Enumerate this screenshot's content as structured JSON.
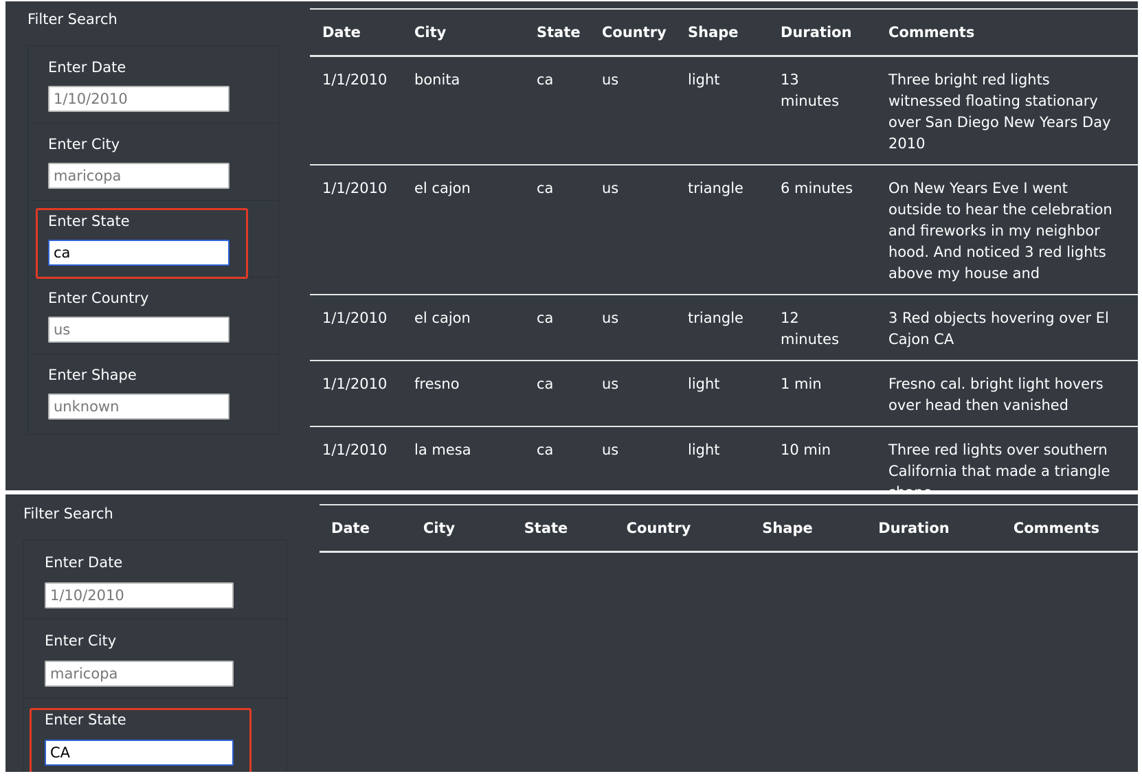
{
  "top": {
    "filter_title": "Filter Search",
    "filters": [
      {
        "label": "Enter Date",
        "placeholder": "1/10/2010",
        "value": ""
      },
      {
        "label": "Enter City",
        "placeholder": "maricopa",
        "value": ""
      },
      {
        "label": "Enter State",
        "placeholder": "",
        "value": "ca"
      },
      {
        "label": "Enter Country",
        "placeholder": "us",
        "value": ""
      },
      {
        "label": "Enter Shape",
        "placeholder": "unknown",
        "value": ""
      }
    ],
    "headers": [
      "Date",
      "City",
      "State",
      "Country",
      "Shape",
      "Duration",
      "Comments"
    ],
    "rows": [
      [
        "1/1/2010",
        "bonita",
        "ca",
        "us",
        "light",
        "13 minutes",
        "Three bright red lights witnessed floating stationary over San Diego New Years Day 2010"
      ],
      [
        "1/1/2010",
        "el cajon",
        "ca",
        "us",
        "triangle",
        "6 minutes",
        "On New Years Eve I went outside to hear the celebration and fireworks in my neighbor hood. And noticed 3 red lights above my house and"
      ],
      [
        "1/1/2010",
        "el cajon",
        "ca",
        "us",
        "triangle",
        "12 minutes",
        "3 Red objects hovering over El Cajon CA"
      ],
      [
        "1/1/2010",
        "fresno",
        "ca",
        "us",
        "light",
        "1 min",
        "Fresno cal. bright light hovers over head then vanished"
      ],
      [
        "1/1/2010",
        "la mesa",
        "ca",
        "us",
        "light",
        "10 min",
        "Three red lights over southern California that made a triangle shape"
      ]
    ]
  },
  "bottom": {
    "filter_title": "Filter Search",
    "filters": [
      {
        "label": "Enter Date",
        "placeholder": "1/10/2010",
        "value": ""
      },
      {
        "label": "Enter City",
        "placeholder": "maricopa",
        "value": ""
      },
      {
        "label": "Enter State",
        "placeholder": "",
        "value": "CA"
      }
    ],
    "headers": [
      "Date",
      "City",
      "State",
      "Country",
      "Shape",
      "Duration",
      "Comments"
    ]
  },
  "colors": {
    "panel_bg": "#343a40",
    "highlight": "#e03a25",
    "focus_border": "#2f63d6"
  }
}
